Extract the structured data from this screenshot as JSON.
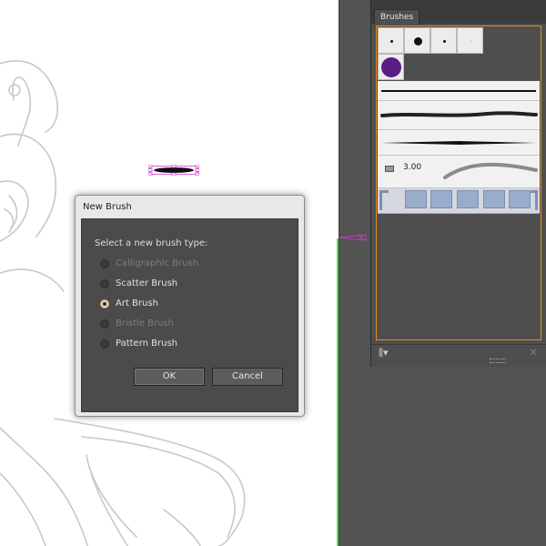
{
  "brushes_panel": {
    "tab_label": "Brushes",
    "art_brush_size": "3.00",
    "calligraphic_color": "#5b1c86"
  },
  "dialog": {
    "title": "New Brush",
    "prompt": "Select a new brush type:",
    "options": [
      {
        "label": "Calligraphic Brush",
        "enabled": false,
        "selected": false
      },
      {
        "label": "Scatter Brush",
        "enabled": true,
        "selected": false
      },
      {
        "label": "Art Brush",
        "enabled": true,
        "selected": true
      },
      {
        "label": "Bristle Brush",
        "enabled": false,
        "selected": false
      },
      {
        "label": "Pattern Brush",
        "enabled": true,
        "selected": false
      }
    ],
    "ok_label": "OK",
    "cancel_label": "Cancel"
  },
  "colors": {
    "selection": "#d33bd3",
    "guide": "#58d858",
    "panel_accent": "#e8891f"
  }
}
